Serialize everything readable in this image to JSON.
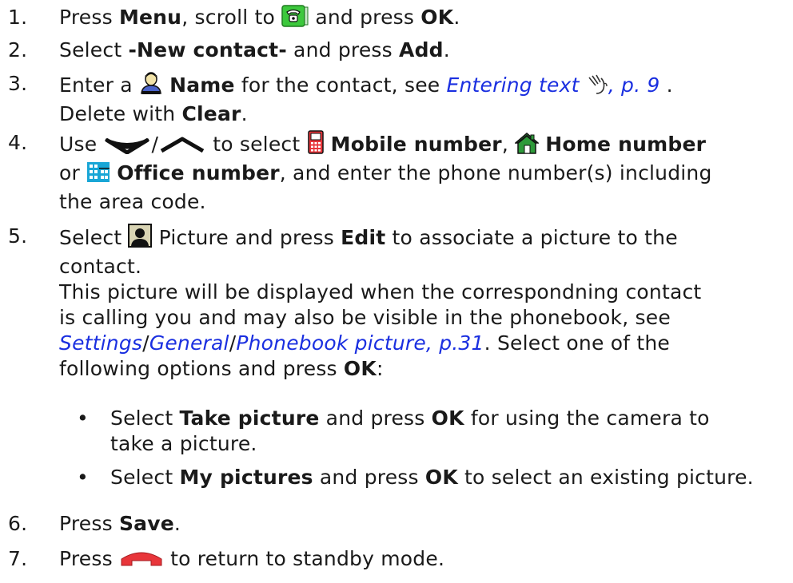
{
  "steps": {
    "s1": {
      "num": "1.",
      "t1": "Press ",
      "b1": "Menu",
      "t2": ", scroll to ",
      "t3": " and press ",
      "b2": "OK",
      "t4": "."
    },
    "s2": {
      "num": "2.",
      "t1": "Select ",
      "b1": "-New contact-",
      "t2": " and press ",
      "b2": "Add",
      "t3": "."
    },
    "s3": {
      "num": "3.",
      "t1": "Enter a ",
      "b1": "Name",
      "t2": " for the contact, see ",
      "link1": "Entering text",
      "link2": ", p. 9",
      "t3": " .",
      "t4": "Delete with ",
      "b2": "Clear",
      "t5": "."
    },
    "s4": {
      "num": "4.",
      "t1": "Use ",
      "t2": "/",
      "t3": " to select ",
      "b1": "Mobile number",
      "t4": ", ",
      "b2": "Home number",
      "t5": "or ",
      "b3": "Office number",
      "t6": ", and enter the phone number(s) including",
      "t7": "the area code."
    },
    "s5": {
      "num": "5.",
      "t1": "Select ",
      "t2": " Picture and press ",
      "b1": "Edit",
      "t3": " to associate a picture to the",
      "t4": "contact.",
      "t5": "This picture will be displayed when the correspondning contact",
      "t6": "is calling you and may also be visible in the phonebook, see",
      "link1": "Settings",
      "sep1": "/",
      "link2": "General",
      "sep2": "/",
      "link3": "Phonebook picture, p.31",
      "t7": ". Select one of the",
      "t8": "following options and press ",
      "b2": "OK",
      "t9": ":"
    },
    "s6": {
      "num": "6.",
      "t1": "Press ",
      "b1": "Save",
      "t2": "."
    },
    "s7": {
      "num": "7.",
      "t1": "Press ",
      "t2": " to return to standby mode."
    }
  },
  "bullets": [
    {
      "mark": "•",
      "t1": "Select ",
      "b1": "Take picture",
      "t2": " and press ",
      "b2": "OK",
      "t3": " for using the camera to",
      "t4": "take a picture."
    },
    {
      "mark": "•",
      "t1": "Select ",
      "b1": "My pictures",
      "t2": " and press ",
      "b2": "OK",
      "t3": " to select an existing picture."
    }
  ],
  "icons": {
    "phonebook": "phonebook-icon",
    "name": "person-name-icon",
    "text_entry": "hand-text-entry-icon",
    "nav_down": "nav-down-icon",
    "nav_up": "nav-up-icon",
    "mobile": "mobile-phone-icon",
    "home": "home-icon",
    "office": "office-building-icon",
    "picture": "contact-picture-icon",
    "end_call": "end-call-key-icon"
  },
  "colors": {
    "link": "#1a2fe0",
    "phonebook": "#3cc83c",
    "end_call": "#e8353a",
    "home": "#2e9a3a"
  }
}
